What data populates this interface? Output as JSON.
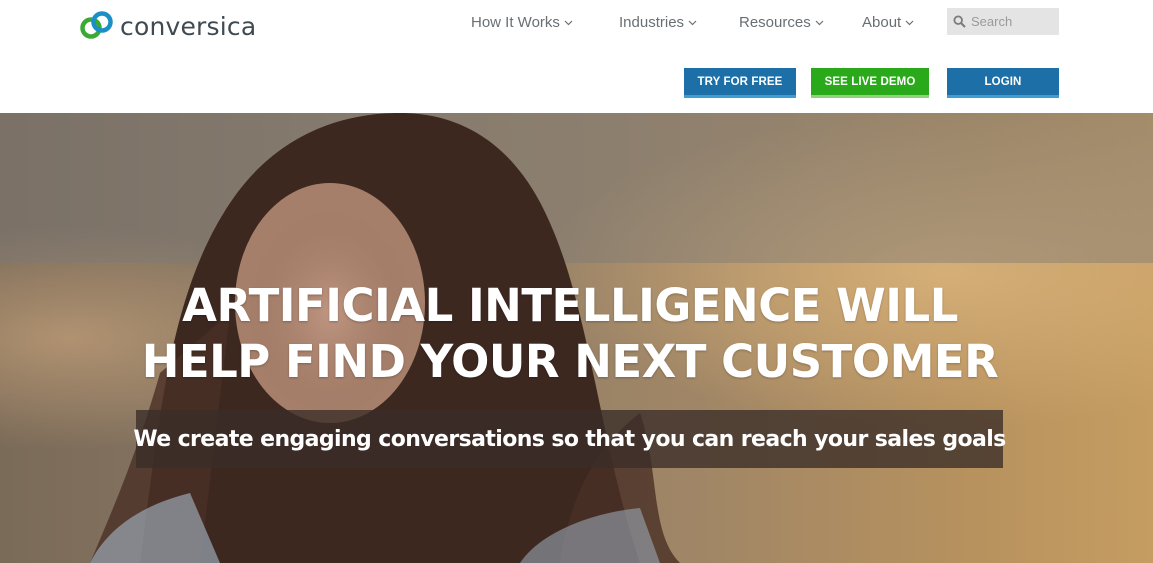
{
  "brand": {
    "name": "conversica",
    "colors": {
      "ring_blue": "#1d8fc7",
      "ring_green": "#3aaa35",
      "text": "#3f4a52"
    }
  },
  "nav": {
    "items": [
      {
        "label": "How It Works"
      },
      {
        "label": "Industries"
      },
      {
        "label": "Resources"
      },
      {
        "label": "About"
      }
    ]
  },
  "search": {
    "placeholder": "Search",
    "value": ""
  },
  "cta": {
    "try_label": "TRY FOR FREE",
    "demo_label": "SEE LIVE DEMO",
    "login_label": "LOGIN"
  },
  "hero": {
    "headline_line1": "ARTIFICIAL INTELLIGENCE WILL",
    "headline_line2": "HELP FIND YOUR NEXT CUSTOMER",
    "subheadline": "We create engaging conversations so that you can reach your sales goals"
  },
  "colors": {
    "primary_button": "#1d6fa8",
    "demo_button": "#2aaa1a",
    "nav_text": "#6a6f73"
  }
}
